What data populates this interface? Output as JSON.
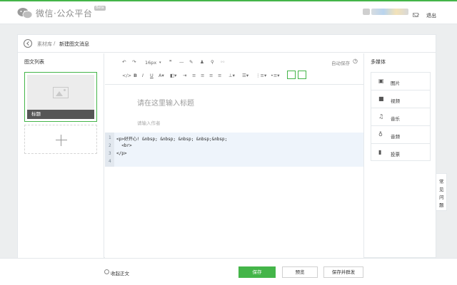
{
  "header": {
    "brand": "微信·公众平台",
    "beta": "Beta",
    "logout": "退出",
    "accent_color": "#44b549"
  },
  "breadcrumb": {
    "parent": "素材库",
    "separator": "/",
    "current": "新建图文消息"
  },
  "left_panel": {
    "title": "图文列表",
    "article_label": "标题"
  },
  "toolbar": {
    "font_size": "16px",
    "autosave": "自动保存"
  },
  "editor": {
    "title_placeholder": "请在这里输入标题",
    "author_placeholder": "请输入作者",
    "code_lines": [
      {
        "num": "1",
        "text": "<p>好开心! &nbsp; &nbsp; &nbsp; &nbsp;&nbsp;"
      },
      {
        "num": "2",
        "text": "  <br>"
      },
      {
        "num": "3",
        "text": "</p>"
      },
      {
        "num": "4",
        "text": ""
      }
    ]
  },
  "right_panel": {
    "title": "多媒体",
    "items": [
      {
        "label": "图片",
        "icon": "image-icon"
      },
      {
        "label": "视频",
        "icon": "video-icon"
      },
      {
        "label": "音乐",
        "icon": "music-icon"
      },
      {
        "label": "音频",
        "icon": "microphone-icon"
      },
      {
        "label": "投票",
        "icon": "vote-icon"
      }
    ]
  },
  "faq": [
    "常",
    "见",
    "问",
    "题"
  ],
  "footer": {
    "collapse_label": "收起正文",
    "save": "保存",
    "preview": "预览",
    "save_and_send": "保存并群发"
  }
}
